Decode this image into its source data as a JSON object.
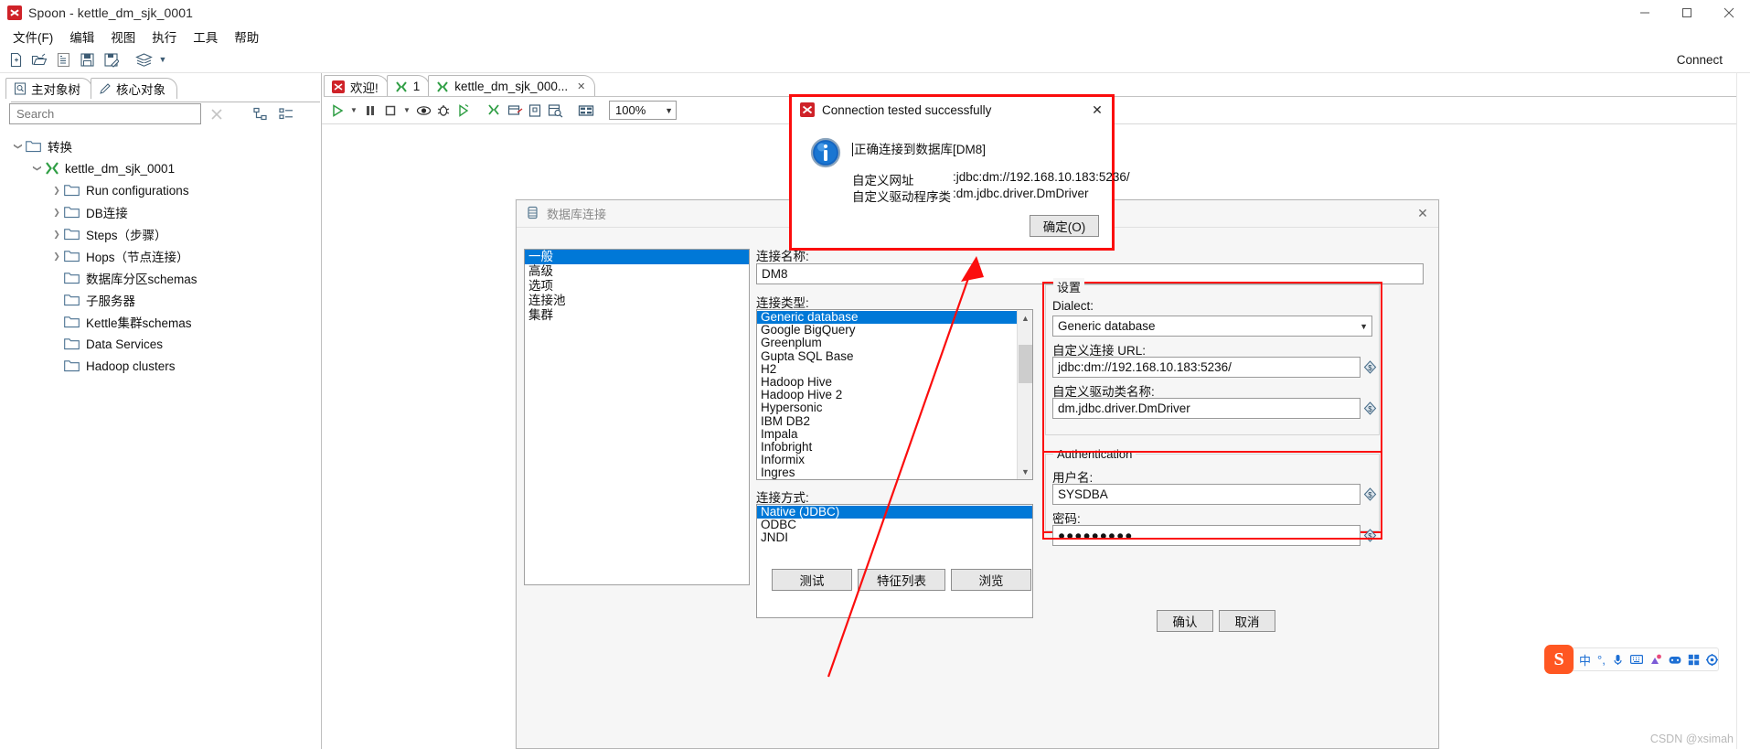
{
  "window": {
    "title": "Spoon - kettle_dm_sjk_0001",
    "icon": "spoon-icon",
    "minimize": "minimize-icon",
    "maximize": "maximize-icon",
    "close": "close-icon"
  },
  "menubar": {
    "items": [
      {
        "label": "文件(F)"
      },
      {
        "label": "编辑"
      },
      {
        "label": "视图"
      },
      {
        "label": "执行"
      },
      {
        "label": "工具"
      },
      {
        "label": "帮助"
      }
    ]
  },
  "toolbar": {
    "icons": [
      "new-file-icon",
      "open-folder-icon",
      "explore-icon",
      "save-icon",
      "save-as-icon",
      "layers-icon"
    ],
    "dropdown_caret": "chevron-down-icon",
    "connect_label": "Connect"
  },
  "left_panel": {
    "tabs": [
      {
        "label": "主对象树",
        "icon": "view-tree-icon",
        "active": true
      },
      {
        "label": "核心对象",
        "icon": "pencil-icon",
        "active": false
      }
    ],
    "search": {
      "value": "",
      "placeholder": "Search",
      "clear_icon": "clear-x-icon",
      "collapse_icon": "collapse-all-icon",
      "expand_icon": "expand-all-icon"
    },
    "tree": [
      {
        "label": "转换",
        "indent": 0,
        "arrow": "down",
        "icon": "folder-icon"
      },
      {
        "label": "kettle_dm_sjk_0001",
        "indent": 1,
        "arrow": "down",
        "icon": "transformation-icon"
      },
      {
        "label": "Run configurations",
        "indent": 2,
        "arrow": "right",
        "icon": "folder-icon"
      },
      {
        "label": "DB连接",
        "indent": 2,
        "arrow": "right",
        "icon": "folder-icon"
      },
      {
        "label": "Steps（步骤）",
        "indent": 2,
        "arrow": "right",
        "icon": "folder-icon"
      },
      {
        "label": "Hops（节点连接）",
        "indent": 2,
        "arrow": "right",
        "icon": "folder-icon"
      },
      {
        "label": "数据库分区schemas",
        "indent": 2,
        "arrow": "none",
        "icon": "folder-icon"
      },
      {
        "label": "子服务器",
        "indent": 2,
        "arrow": "none",
        "icon": "folder-icon"
      },
      {
        "label": "Kettle集群schemas",
        "indent": 2,
        "arrow": "none",
        "icon": "folder-icon"
      },
      {
        "label": "Data Services",
        "indent": 2,
        "arrow": "none",
        "icon": "folder-icon"
      },
      {
        "label": "Hadoop clusters",
        "indent": 2,
        "arrow": "none",
        "icon": "folder-icon"
      }
    ]
  },
  "editor": {
    "tabs": [
      {
        "label": "欢迎!",
        "icon": "spoon-icon",
        "closable": false,
        "active": false
      },
      {
        "label": "1",
        "icon": "transformation-icon",
        "closable": false,
        "active": false
      },
      {
        "label": "kettle_dm_sjk_000...",
        "icon": "transformation-icon",
        "closable": true,
        "active": true
      }
    ],
    "tab_close_icon": "close-tab-icon",
    "run_toolbar": {
      "icons": [
        "run-icon",
        "run-options-caret-icon",
        "pause-icon",
        "stop-icon",
        "stop-options-caret-icon",
        "preview-icon",
        "debug-icon",
        "replay-icon",
        "verify-icon",
        "analyze-icon",
        "schedule-icon",
        "inspect-data-icon",
        "grid-icon"
      ],
      "zoom": {
        "value": "100%",
        "caret": "chevron-down-icon"
      }
    }
  },
  "db_dialog": {
    "title": "数据库连接",
    "title_icon": "database-icon",
    "close_icon": "close-icon",
    "nav_items": [
      {
        "label": "一般",
        "selected": true
      },
      {
        "label": "高级",
        "selected": false
      },
      {
        "label": "选项",
        "selected": false
      },
      {
        "label": "连接池",
        "selected": false
      },
      {
        "label": "集群",
        "selected": false
      }
    ],
    "connection_name": {
      "label": "连接名称:",
      "value": "DM8"
    },
    "connection_type": {
      "label": "连接类型:",
      "options": [
        "Generic database",
        "Google BigQuery",
        "Greenplum",
        "Gupta SQL Base",
        "H2",
        "Hadoop Hive",
        "Hadoop Hive 2",
        "Hypersonic",
        "IBM DB2",
        "Impala",
        "Infobright",
        "Informix",
        "Ingres"
      ],
      "selected": "Generic database",
      "scroll_up_icon": "chevron-up-icon",
      "scroll_down_icon": "chevron-down-icon"
    },
    "access_method": {
      "label": "连接方式:",
      "options": [
        "Native (JDBC)",
        "ODBC",
        "JNDI"
      ],
      "selected": "Native (JDBC)"
    },
    "settings": {
      "group_title": "设置",
      "dialect": {
        "label": "Dialect:",
        "value": "Generic database",
        "caret": "chevron-down-icon"
      },
      "custom_url": {
        "label": "自定义连接 URL:",
        "value": "jdbc:dm://192.168.10.183:5236/",
        "variable_icon": "variable-icon"
      },
      "custom_driver": {
        "label": "自定义驱动类名称:",
        "value": "dm.jdbc.driver.DmDriver",
        "variable_icon": "variable-icon"
      }
    },
    "authentication": {
      "group_title": "Authentication",
      "username": {
        "label": "用户名:",
        "value": "SYSDBA",
        "variable_icon": "variable-icon"
      },
      "password": {
        "label": "密码:",
        "value": "●●●●●●●●●",
        "variable_icon": "variable-icon"
      }
    },
    "buttons": {
      "test": "测试",
      "feature_list": "特征列表",
      "explore": "浏览",
      "ok": "确认",
      "cancel": "取消"
    }
  },
  "success_dialog": {
    "title": "Connection tested successfully",
    "title_icon": "spoon-icon",
    "close_icon": "close-icon",
    "info_icon": "info-icon",
    "message": "正确连接到数据库[DM8]",
    "details": [
      {
        "key": "自定义网址",
        "value": ":jdbc:dm://192.168.10.183:5236/"
      },
      {
        "key": "自定义驱动程序类",
        "value": ":dm.jdbc.driver.DmDriver"
      }
    ],
    "ok_button": "确定(O)"
  },
  "annotations": {
    "arrow_color": "#fb0d0d",
    "highlight_color": "#fb0d0d"
  },
  "ime_tray": {
    "logo": "S",
    "items": [
      "中",
      "°,",
      "microphone-icon",
      "keyboard-icon",
      "expression-icon",
      "game-icon",
      "apps-icon",
      "settings-icon"
    ]
  },
  "watermark": "CSDN @xsimah"
}
